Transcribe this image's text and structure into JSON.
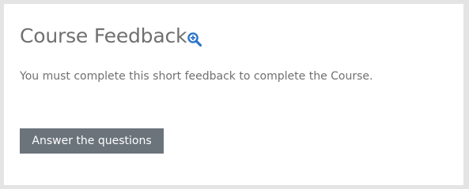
{
  "feedback": {
    "title": "Course Feedback",
    "zoom_icon": "magnifier-plus-icon",
    "message": "You must complete this short feedback to complete the Course.",
    "answer_button_label": "Answer the questions"
  },
  "colors": {
    "page_background": "#e4e4e4",
    "card_background": "#ffffff",
    "text": "#707070",
    "button_background": "#6b737b",
    "button_text": "#ffffff",
    "icon_blue": "#2b74c9"
  }
}
